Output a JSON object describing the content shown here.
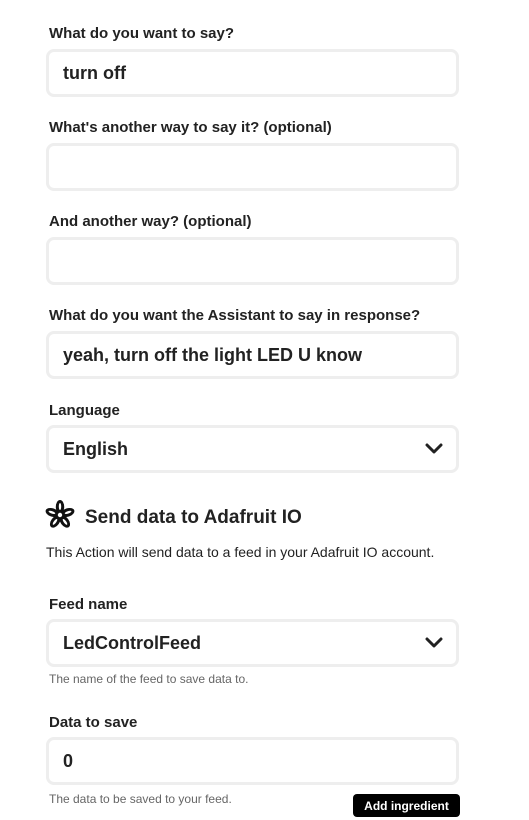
{
  "fields": {
    "say": {
      "label": "What do you want to say?",
      "value": "turn off"
    },
    "say_alt1": {
      "label": "What's another way to say it? (optional)",
      "value": ""
    },
    "say_alt2": {
      "label": "And another way? (optional)",
      "value": ""
    },
    "response": {
      "label": "What do you want the Assistant to say in response?",
      "value": "yeah, turn off the light LED U know"
    },
    "language": {
      "label": "Language",
      "value": "English",
      "icon": "chevron-down-icon"
    }
  },
  "action": {
    "icon": "adafruit-logo-icon",
    "title": "Send data to Adafruit IO",
    "description": "This Action will send data to a feed in your Adafruit IO account."
  },
  "feed": {
    "label": "Feed name",
    "value": "LedControlFeed",
    "helper": "The name of the feed to save data to.",
    "icon": "chevron-down-icon"
  },
  "data": {
    "label": "Data to save",
    "value": "0",
    "helper": "The data to be saved to your feed.",
    "add_ingredient_label": "Add ingredient"
  },
  "colors": {
    "text": "#222222",
    "border": "#eeeeee",
    "helper": "#666666",
    "button_bg": "#000000",
    "button_text": "#ffffff"
  }
}
